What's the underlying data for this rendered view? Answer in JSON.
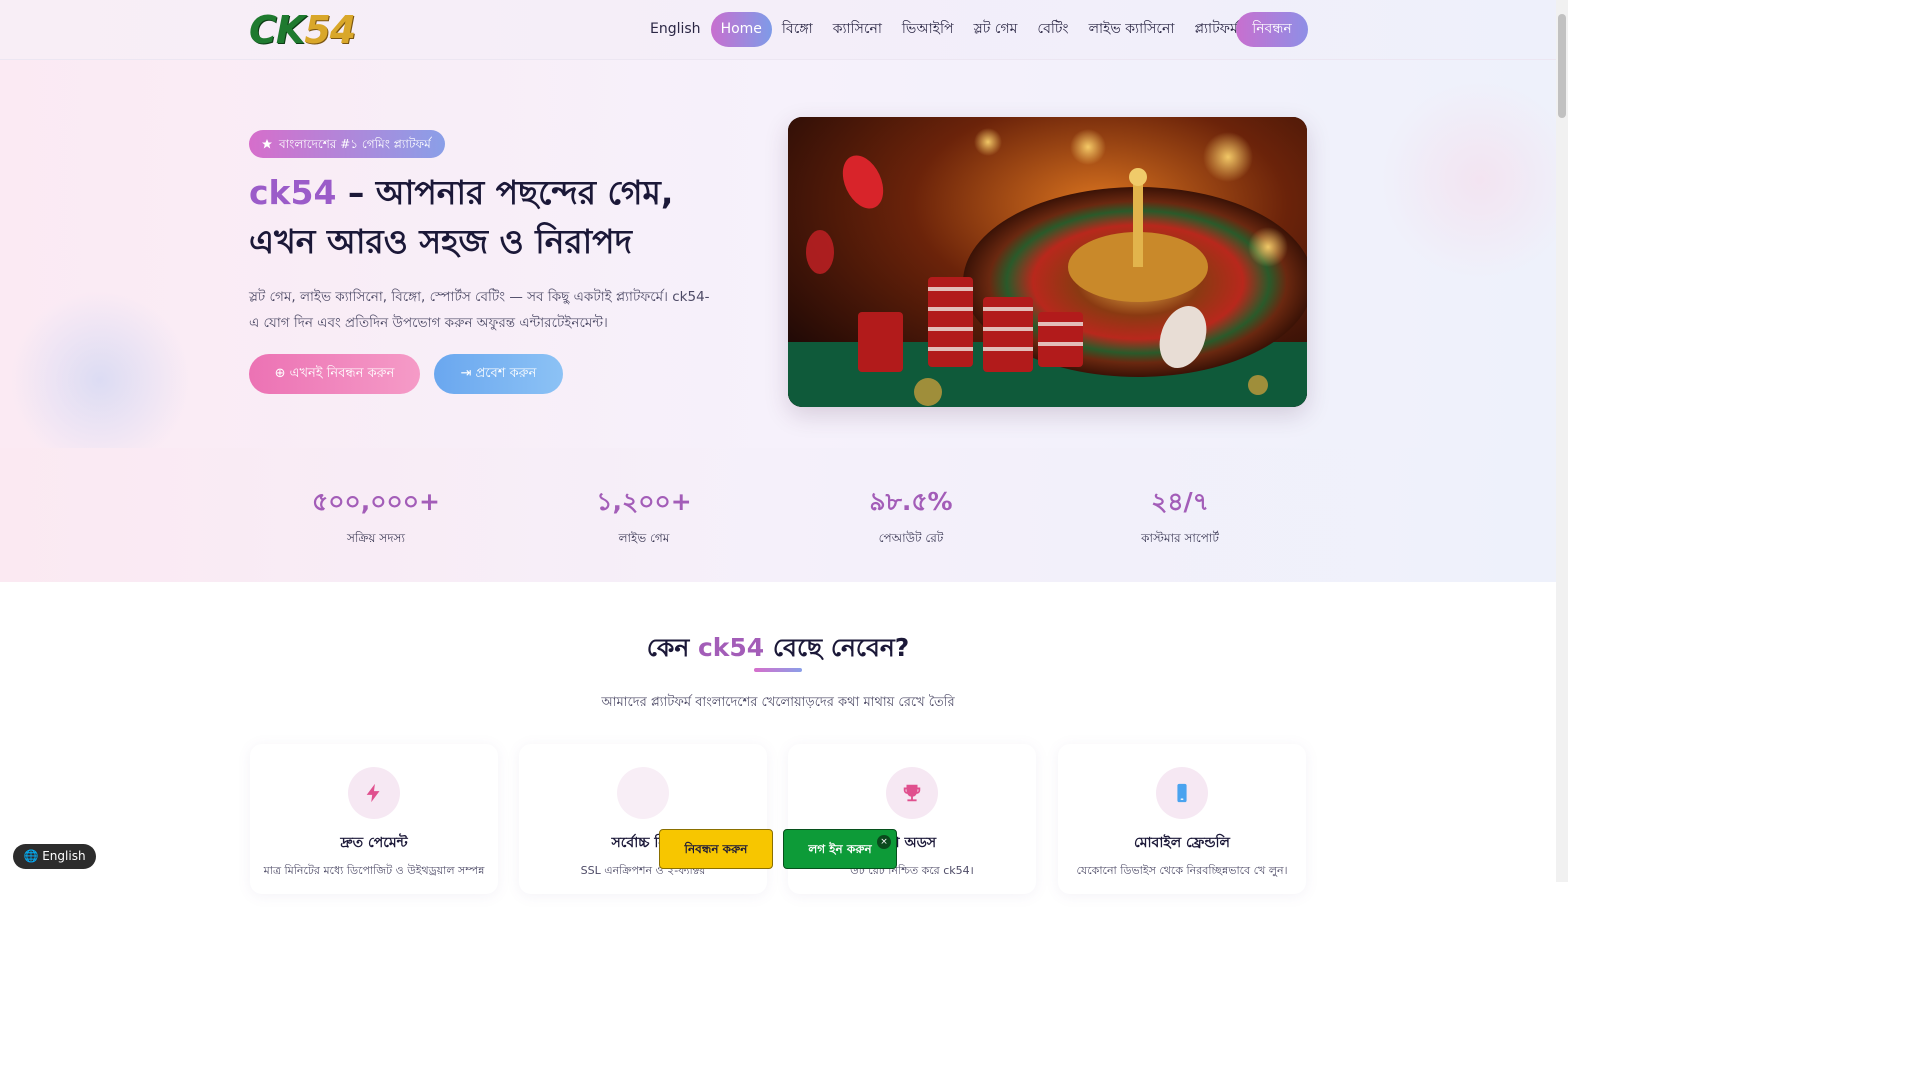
{
  "header": {
    "logo_part1": "CK",
    "logo_part2": "54",
    "nav": [
      "English",
      "Home",
      "বিঙ্গো",
      "ক্যাসিনো",
      "ভিআইপি",
      "স্লট গেম",
      "বেটিং",
      "লাইভ ক্যাসিনো",
      "প্ল্যাটফর্ম"
    ],
    "active_nav": "Home",
    "register_label": "নিবন্ধন"
  },
  "hero": {
    "badge_icon": "star-icon",
    "badge": "বাংলাদেশের #১ গেমিং প্ল্যাটফর্ম",
    "title_brand": "ck54",
    "title_rest": " – আপনার পছন্দের গেম, এখন আরও সহজ ও নিরাপদ",
    "description": "স্লট গেম, লাইভ ক্যাসিনো, বিঙ্গো, স্পোর্টস বেটিং — সব কিছু একটাই প্ল্যাটফর্মে। ck54-এ যোগ দিন এবং প্রতিদিন উপভোগ করুন অফুরন্ত এন্টারটেইনমেন্ট।",
    "primary_button": "এখনই নিবন্ধন করুন",
    "primary_icon": "user-plus-icon",
    "secondary_button": "প্রবেশ করুন",
    "secondary_icon": "login-icon",
    "image_desc": "roulette-wheel-casino-image"
  },
  "stats": [
    {
      "value": "৫০০,০০০+",
      "label": "সক্রিয় সদস্য"
    },
    {
      "value": "১,২০০+",
      "label": "লাইভ গেম"
    },
    {
      "value": "৯৮.৫%",
      "label": "পেআউট রেট"
    },
    {
      "value": "২৪/৭",
      "label": "কাস্টমার সাপোর্ট"
    }
  ],
  "why": {
    "title_pre": "কেন ",
    "title_brand": "ck54",
    "title_post": " বেছে নেবেন?",
    "subtitle": "আমাদের প্ল্যাটফর্ম বাংলাদেশের খেলোয়াড়দের কথা মাথায় রেখে তৈরি",
    "features": [
      {
        "icon": "lightning-icon",
        "title": "দ্রুত পেমেন্ট",
        "desc": "মাত্র মিনিটের মধ্যে ডিপোজিট ও উইথড্রয়াল সম্পন্ন"
      },
      {
        "icon": "shield-icon",
        "title": "সর্বোচ্চ নির",
        "desc": "SSL এনক্রিপশন ও ২-ফ্যাক্টর"
      },
      {
        "icon": "trophy-icon",
        "title": "রা অডস",
        "desc": "উট রেট নিশ্চিত করে ck54।"
      },
      {
        "icon": "mobile-icon",
        "title": "মোবাইল ফ্রেন্ডলি",
        "desc": "যেকোনো ডিভাইস থেকে নিরবচ্ছিন্নভাবে খে লুন।"
      }
    ]
  },
  "floating": {
    "language": "English",
    "register": "নিবন্ধন করুন",
    "login": "লগ ইন করুন",
    "close": "×"
  },
  "colors": {
    "brand_purple": "#a35db8",
    "accent_pink": "#ec72b4",
    "accent_blue": "#6aa7ef",
    "float_yellow": "#f7c600",
    "float_green": "#0d9b38"
  }
}
